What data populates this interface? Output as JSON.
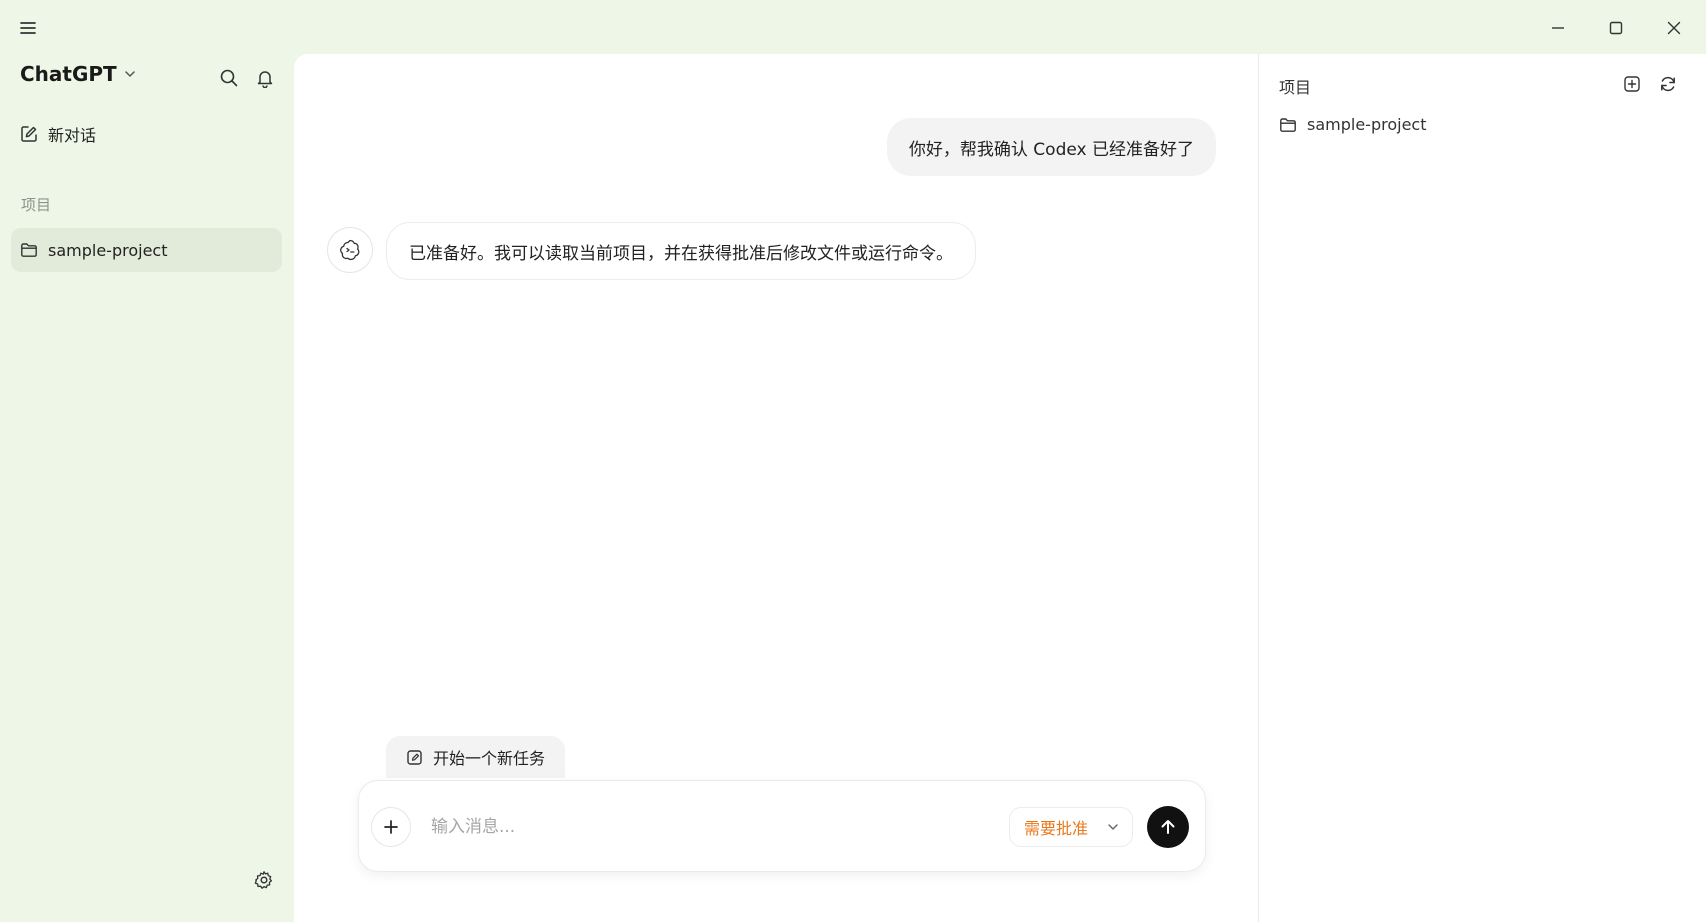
{
  "sidebar": {
    "brand": "ChatGPT",
    "new_chat_label": "新对话",
    "section_title": "项目",
    "projects": [
      {
        "label": "sample-project"
      }
    ]
  },
  "conversation": {
    "messages": [
      {
        "role": "user",
        "text": "你好，帮我确认 Codex 已经准备好了"
      },
      {
        "role": "assistant",
        "text": "已准备好。我可以读取当前项目，并在获得批准后修改文件或运行命令。"
      }
    ]
  },
  "composer": {
    "new_task_label": "开始一个新任务",
    "placeholder": "输入消息...",
    "approval_label": "需要批准"
  },
  "right_panel": {
    "title": "项目",
    "projects": [
      {
        "label": "sample-project"
      }
    ]
  },
  "colors": {
    "sidebar_bg": "#eef6e8",
    "approval_accent": "#e9791d",
    "send_button": "#111111"
  },
  "icons": [
    "menu-icon",
    "chevron-down-icon",
    "search-icon",
    "bell-icon",
    "edit-icon",
    "folder-icon",
    "settings-icon",
    "minimize-icon",
    "maximize-icon",
    "close-icon",
    "assistant-logo-icon",
    "task-icon",
    "plus-icon",
    "arrow-up-icon",
    "new-folder-icon",
    "refresh-icon"
  ]
}
